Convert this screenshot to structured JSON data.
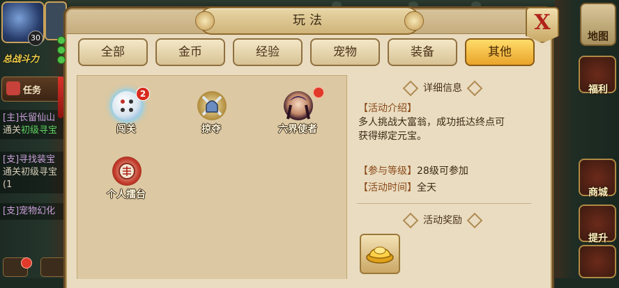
{
  "hud": {
    "player_level": "30",
    "power_label": "总战斗力",
    "task_label": "任务",
    "quests": [
      {
        "title": "[主]长留仙山",
        "desc_prefix": "通关",
        "desc_highlight": "初级寻宝",
        "desc_suffix": ""
      },
      {
        "title": "[支]寻找装宝",
        "desc_prefix": "通关初级寻宝",
        "desc_highlight": "",
        "desc_suffix": "(1"
      },
      {
        "title": "[支]宠物幻化",
        "desc_prefix": "",
        "desc_highlight": "",
        "desc_suffix": ""
      }
    ],
    "right_buttons": {
      "map": "地图",
      "welfare": "福利",
      "shop": "商城",
      "upgrade": "提升"
    }
  },
  "window": {
    "title": "玩法",
    "close_glyph": "X"
  },
  "tabs": [
    {
      "label": "全部",
      "active": false
    },
    {
      "label": "金币",
      "active": false
    },
    {
      "label": "经验",
      "active": false
    },
    {
      "label": "宠物",
      "active": false
    },
    {
      "label": "装备",
      "active": false
    },
    {
      "label": "其他",
      "active": true
    }
  ],
  "activities": [
    {
      "name": "闯关",
      "icon": "dice-icon",
      "badge": "2"
    },
    {
      "name": "掠夺",
      "icon": "crossed-swords-helmet-icon",
      "badge": ""
    },
    {
      "name": "六界使者",
      "icon": "envoy-portrait-icon",
      "badge": ""
    },
    {
      "name": "个人擂台",
      "icon": "arena-drum-icon",
      "badge": ""
    }
  ],
  "detail": {
    "header": "详细信息",
    "intro_label": "【活动介绍】",
    "intro_text_1": "多人挑战大富翁，成功抵达终点可",
    "intro_text_2": "获得绑定元宝。",
    "level_label": "【参与等级】",
    "level_value": "28级可参加",
    "time_label": "【活动时间】",
    "time_value": "全天",
    "reward_header": "活动奖励",
    "reward_item_icon": "gold-ingot-icon"
  },
  "colors": {
    "panel_bg": "#e9dcc0",
    "active_tab": "#e9a42a",
    "close_x": "#b0221a",
    "badge_red": "#d92a1e"
  }
}
